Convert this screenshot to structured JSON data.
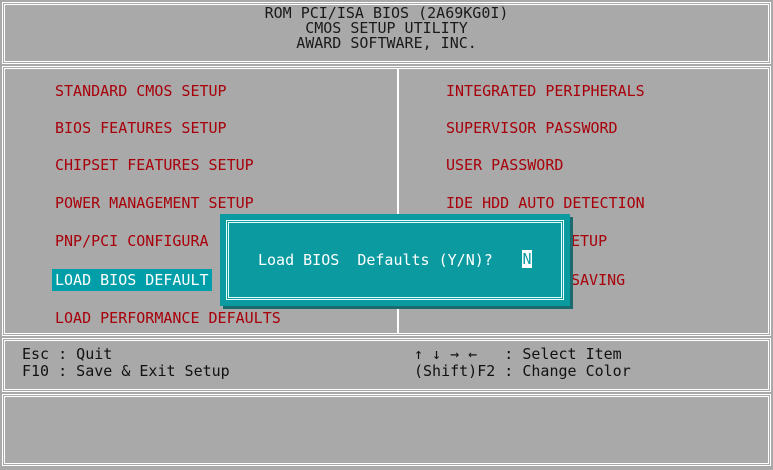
{
  "header": {
    "line1": "ROM PCI/ISA BIOS (2A69KG0I)",
    "line2": "CMOS SETUP UTILITY",
    "line3": "AWARD SOFTWARE, INC."
  },
  "menu": {
    "left": [
      {
        "label": "STANDARD CMOS SETUP"
      },
      {
        "label": "BIOS FEATURES SETUP"
      },
      {
        "label": "CHIPSET FEATURES SETUP"
      },
      {
        "label": "POWER MANAGEMENT SETUP"
      },
      {
        "label": "PNP/PCI CONFIGURA"
      },
      {
        "label": "LOAD BIOS DEFAULT",
        "selected": true
      },
      {
        "label": "LOAD PERFORMANCE DEFAULTS"
      }
    ],
    "right": [
      {
        "label": "INTEGRATED PERIPHERALS"
      },
      {
        "label": "SUPERVISOR PASSWORD"
      },
      {
        "label": "USER PASSWORD"
      },
      {
        "label": "IDE HDD AUTO DETECTION"
      },
      {
        "label": "ETUP"
      },
      {
        "label": "SAVING"
      }
    ]
  },
  "help": {
    "esc": "Esc : Quit",
    "f10": "F10 : Save & Exit Setup",
    "select": "↑ ↓ → ←   : Select Item",
    "color": "(Shift)F2 : Change Color"
  },
  "dialog": {
    "prompt": "Load BIOS  Defaults (Y/N)?",
    "value": "N"
  },
  "colors": {
    "background": "#a9a9a9",
    "menu_text": "#a8000a",
    "highlight": "#009ea8",
    "dialog_bg": "#0a9aa0",
    "border": "#ffffff"
  }
}
